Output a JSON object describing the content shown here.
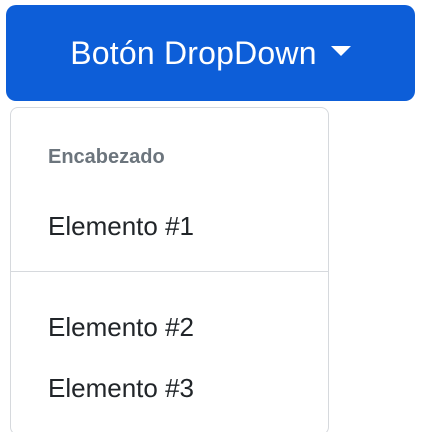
{
  "dropdown": {
    "toggle_label": "Botón DropDown",
    "toggle_color": "#0d5ed8",
    "caret_icon": "caret-down-icon",
    "header": "Encabezado",
    "items": [
      {
        "label": "Elemento #1"
      },
      {
        "label": "Elemento #2"
      },
      {
        "label": "Elemento #3"
      }
    ]
  }
}
